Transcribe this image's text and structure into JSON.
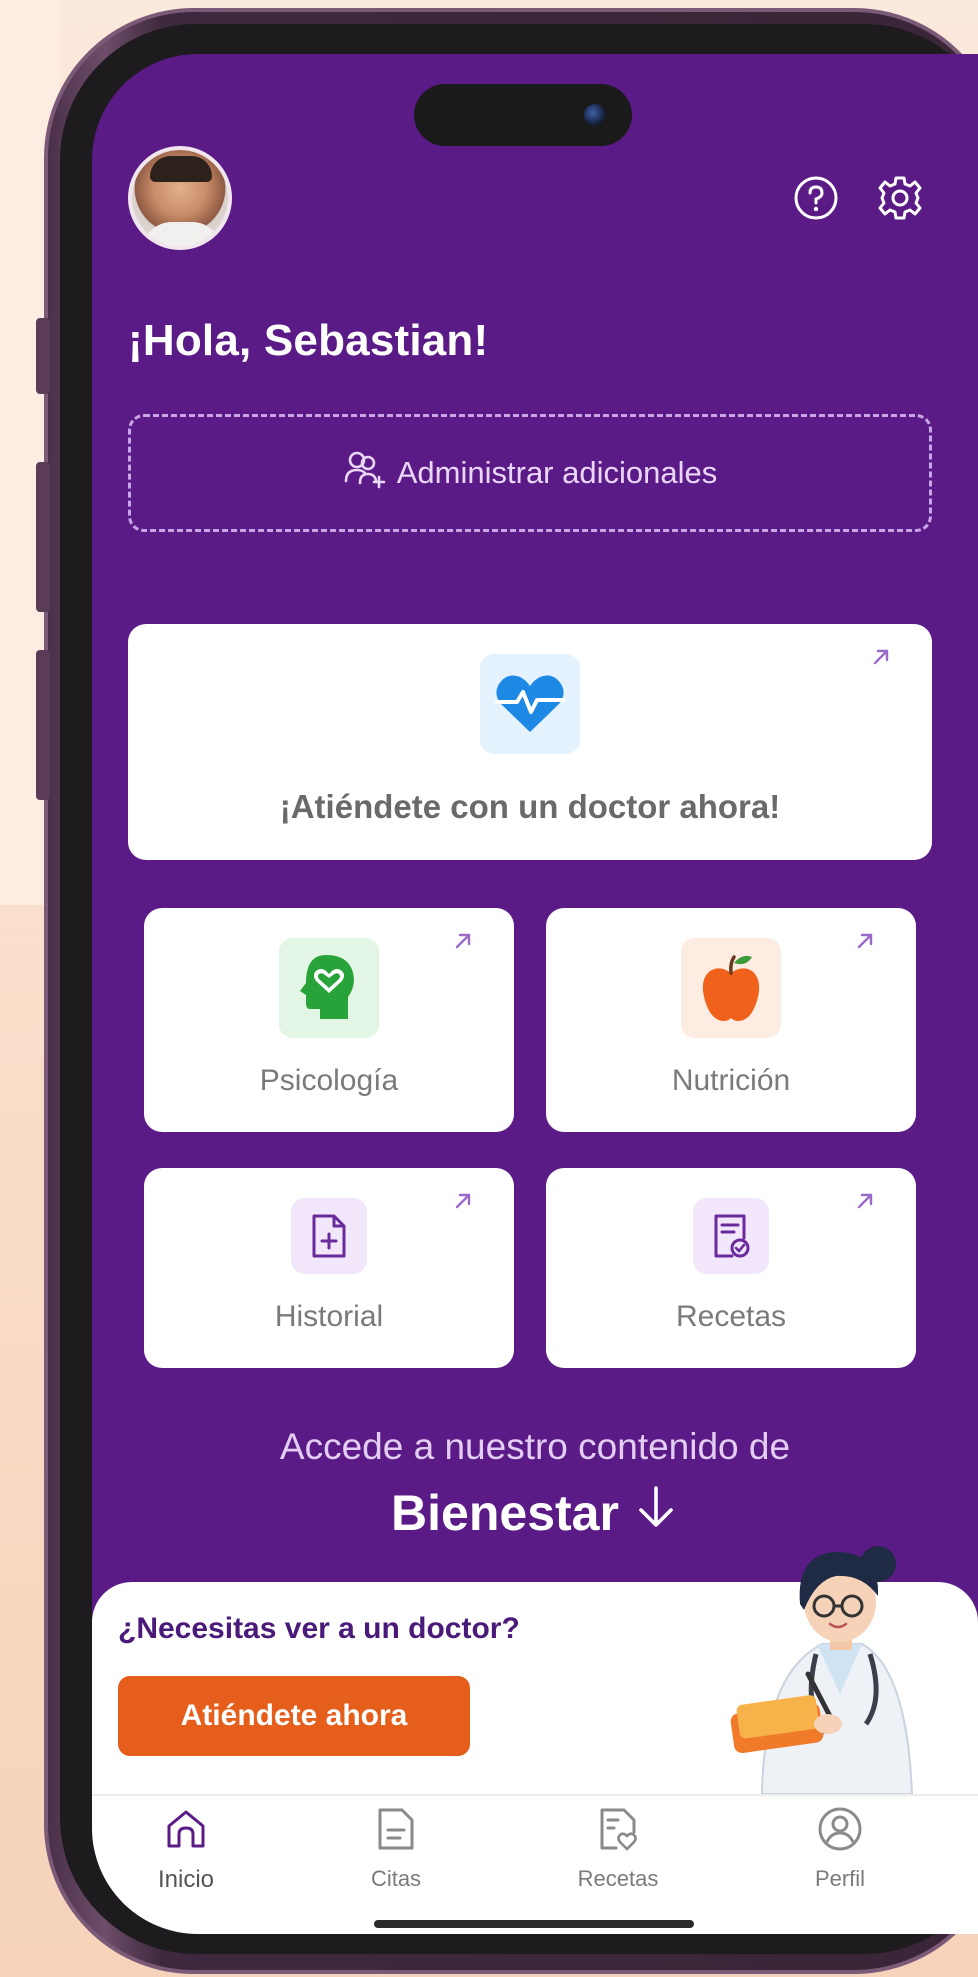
{
  "user": {
    "greeting": "¡Hola, Sebastian!"
  },
  "header": {
    "help_icon": "help-circle-icon",
    "settings_icon": "gear-icon"
  },
  "manage": {
    "label": "Administrar adicionales",
    "icon": "users-plus-icon"
  },
  "main_card": {
    "label": "¡Atiéndete con un doctor ahora!",
    "icon": "heartbeat-icon"
  },
  "services": [
    {
      "label": "Psicología",
      "icon": "head-heart-icon"
    },
    {
      "label": "Nutrición",
      "icon": "apple-icon"
    },
    {
      "label": "Historial",
      "icon": "file-plus-icon"
    },
    {
      "label": "Recetas",
      "icon": "prescription-icon"
    }
  ],
  "wellness": {
    "intro": "Accede a nuestro contenido de",
    "title": "Bienestar"
  },
  "promo": {
    "title": "¿Necesitas ver a un doctor?",
    "button": "Atiéndete ahora"
  },
  "tabs": [
    {
      "label": "Inicio",
      "icon": "home-icon",
      "active": true
    },
    {
      "label": "Citas",
      "icon": "document-icon",
      "active": false
    },
    {
      "label": "Recetas",
      "icon": "prescription-heart-icon",
      "active": false
    },
    {
      "label": "Perfil",
      "icon": "user-circle-icon",
      "active": false
    }
  ],
  "colors": {
    "primary": "#5b1b86",
    "accent": "#e65e1b",
    "card": "#ffffff"
  }
}
